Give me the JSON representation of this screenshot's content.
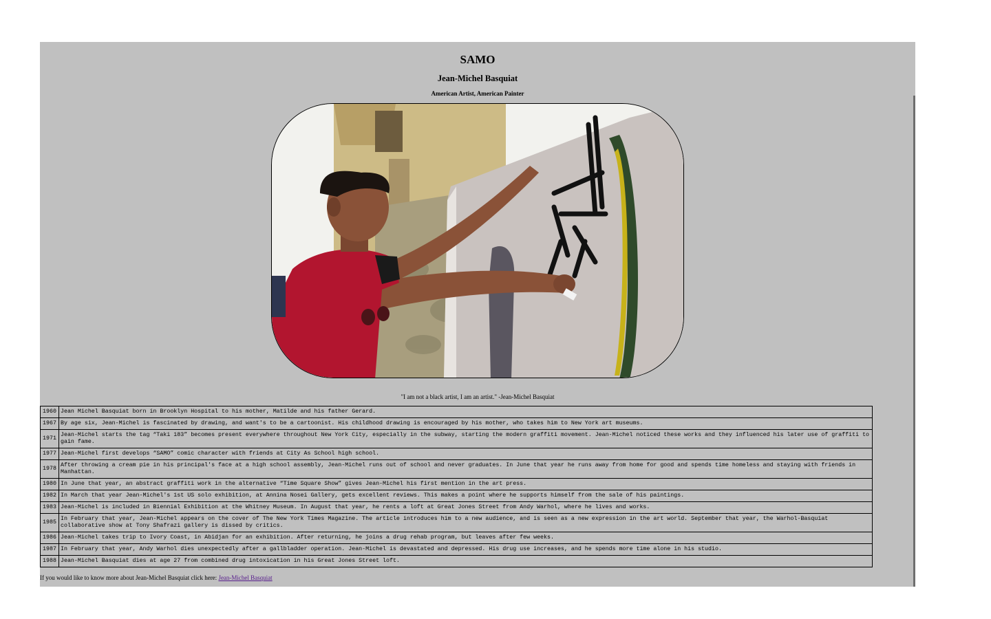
{
  "header": {
    "title": "SAMO",
    "subtitle": "Jean-Michel Basquiat",
    "tagline": "American Artist, American Painter"
  },
  "quote": "\"I am not a black artist, I am an artist.\" -Jean-Michel Basquiat",
  "timeline": [
    {
      "year": "1960",
      "text": "Jean Michel Basquiat born in Brooklyn Hospital to his mother, Matilde and his father Gerard."
    },
    {
      "year": "1967",
      "text": "By age six, Jean-Michel is fascinated by drawing, and want's to be a cartoonist. His childhood drawing is encouraged by his mother, who takes him to New York art museums."
    },
    {
      "year": "1971",
      "text": "Jean-Michel starts the tag “Taki 183” becomes present everywhere throughout New York City, especially in the subway, starting the modern graffiti movement. Jean-Michel noticed these works and they influenced his later use of graffiti to gain fame."
    },
    {
      "year": "1977",
      "text": "Jean-Michel first develops “SAMO” comic character with friends at City As School high school."
    },
    {
      "year": "1978",
      "text": "After throwing a cream pie in his principal's face at a high school assembly, Jean-Michel runs out of school and never graduates. In June that year he runs away from home for good and spends time homeless and staying with friends in Manhattan."
    },
    {
      "year": "1980",
      "text": "In June that year, an abstract graffiti work in the alternative “Time Square Show” gives Jean-Michel his first mention in the art press."
    },
    {
      "year": "1982",
      "text": "In March that year Jean-Michel's 1st US solo exhibition, at Annina Nosei Gallery, gets excellent reviews. This makes a point where he supports himself from the sale of his paintings."
    },
    {
      "year": "1983",
      "text": "Jean-Michel is included in Biennial Exhibition at the Whitney Museum. In August that year, he rents a loft at Great Jones Street from Andy Warhol, where he lives and works."
    },
    {
      "year": "1985",
      "text": "In February that year, Jean-Michel appears on the cover of The New York Times Magazine. The article introduces him to a new audience, and is seen as a new expression in the art world. September that year, the Warhol-Basquiat collaborative show at Tony Shafrazi gallery is dissed by critics."
    },
    {
      "year": "1986",
      "text": "Jean-Michel takes trip to Ivory Coast, in Abidjan for an exhibition. After returning, he joins a drug rehab program, but leaves after few weeks."
    },
    {
      "year": "1987",
      "text": "In February that year, Andy Warhol dies unexpectedly after a gallbladder operation. Jean-Michel is devastated and depressed. His drug use increases, and he spends more time alone in his studio."
    },
    {
      "year": "1988",
      "text": "Jean-Michel Basquiat dies at age 27 from combined drug intoxication in his Great Jones Street loft."
    }
  ],
  "footer": {
    "prefix": "If you would like to know more about Jean-Michel Basquiat click here: ",
    "link_label": "Jean-Michel Basquiat"
  },
  "colors": {
    "page_background": "#c0c0c0",
    "link": "#551a8b"
  }
}
